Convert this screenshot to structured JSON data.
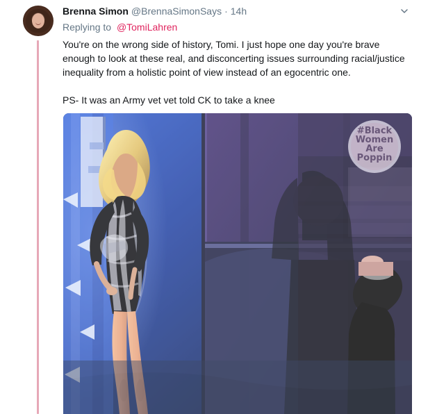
{
  "tweet": {
    "author": {
      "name": "Brenna Simon",
      "handle": "@BrennaSimonSays",
      "separator": "·",
      "time": "14h",
      "avatar_icon": "profile-photo"
    },
    "reply": {
      "prefix": "Replying to",
      "mention": "@TomiLahren"
    },
    "text": {
      "paragraph_1": "You're on the wrong side of history, Tomi. I just hope one day you're brave enough to look at these real, and disconcerting issues surrounding racial/justice inequality from a holistic point of view instead of an egocentric one.",
      "paragraph_2": "PS- It was an Army vet vet told CK to take a knee"
    },
    "media": {
      "overlay_text": [
        "#Black",
        "Women",
        "Are",
        "Poppin"
      ]
    },
    "icons": {
      "menu": "chevron-down-icon",
      "thread": "thread-line"
    },
    "colors": {
      "thread_line": "#e6a8b7",
      "mention": "#e0245e",
      "secondary_text": "#657786",
      "primary_text": "#14171a"
    }
  }
}
